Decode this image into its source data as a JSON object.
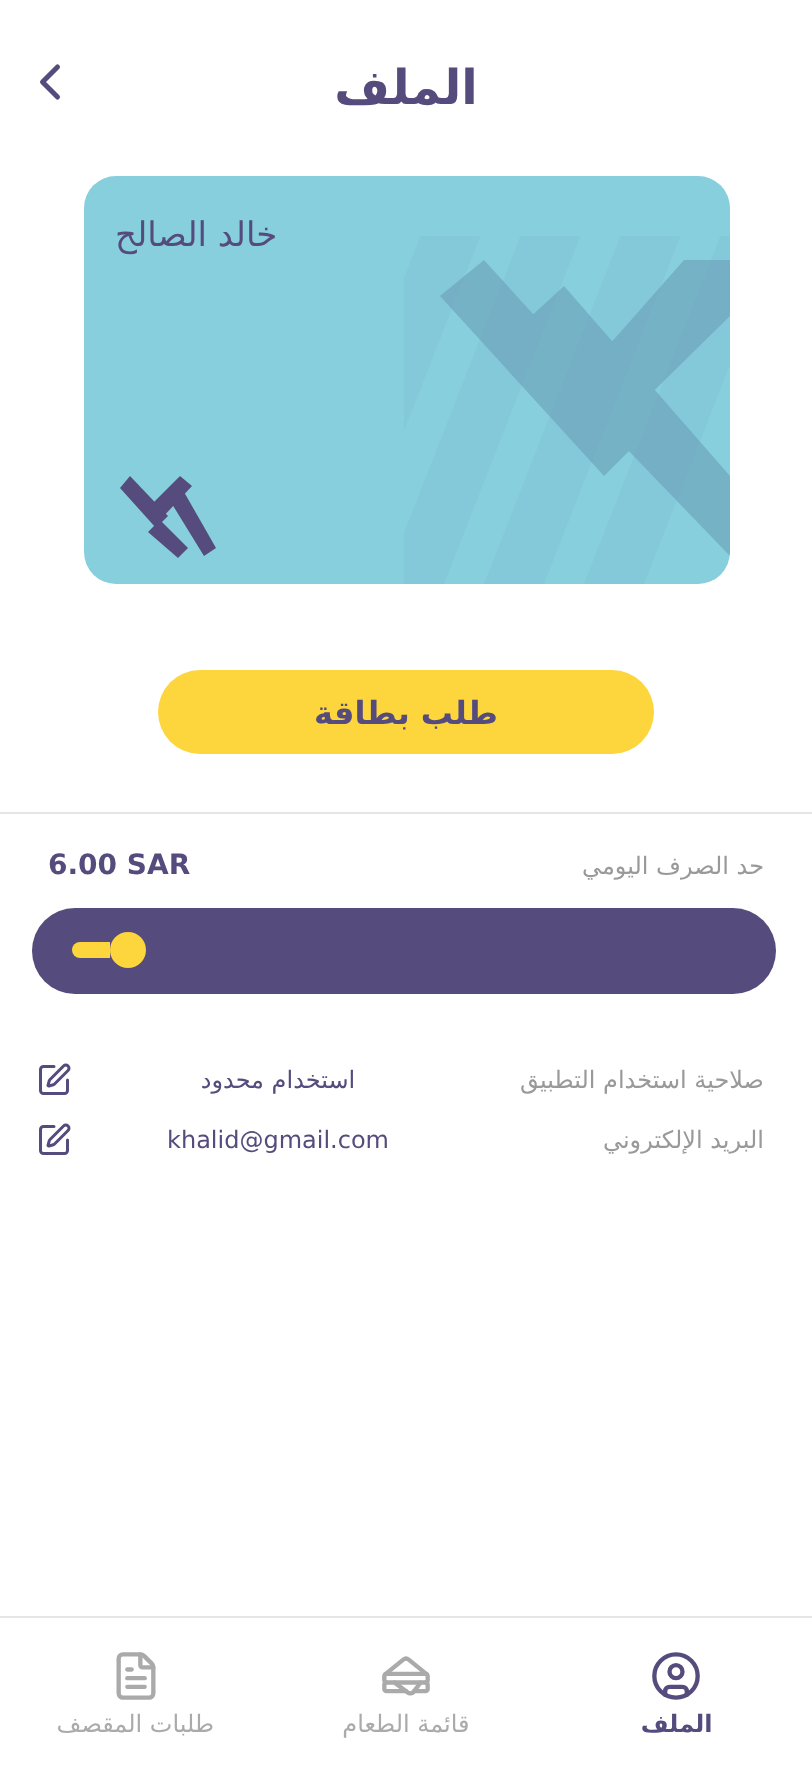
{
  "header": {
    "title": "الملف"
  },
  "card": {
    "holder": "خالد الصالح"
  },
  "request_button": "طلب بطاقة",
  "spending_limit": {
    "label": "حد الصرف اليومي",
    "amount": "6.00 SAR",
    "level": 0.13
  },
  "fields": [
    {
      "label": "صلاحية استخدام التطبيق",
      "value": "استخدام محدود"
    },
    {
      "label": "البريد الإلكتروني",
      "value": "khalid@gmail.com"
    }
  ],
  "nav": [
    {
      "label": "الملف",
      "selected": true
    },
    {
      "label": "قائمة الطعام",
      "selected": false
    },
    {
      "label": "طلبات المقصف",
      "selected": false
    }
  ]
}
